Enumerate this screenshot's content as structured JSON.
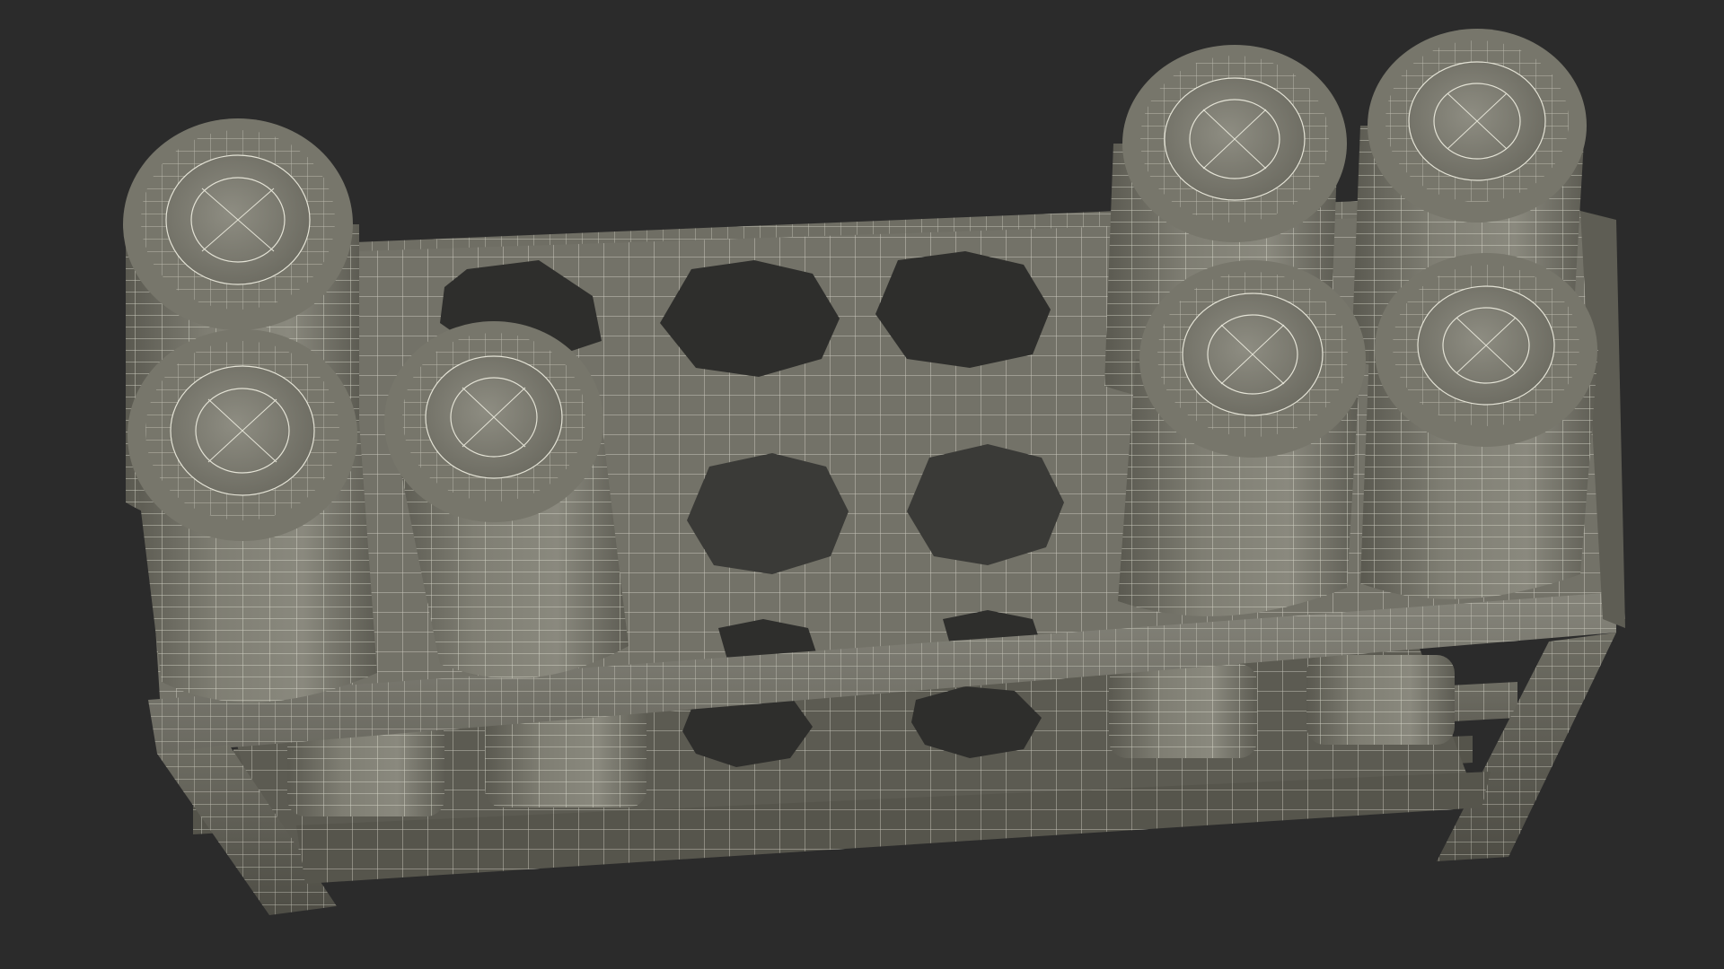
{
  "scene": {
    "subject": "wireframe-model",
    "colors": {
      "background": "#2b2b2b",
      "surface_light": "#7d7c70",
      "surface_mid": "#66655a",
      "surface_dark": "#4b4a42",
      "hole": "#2e2e2c",
      "wire": "#e4e3d6"
    }
  }
}
